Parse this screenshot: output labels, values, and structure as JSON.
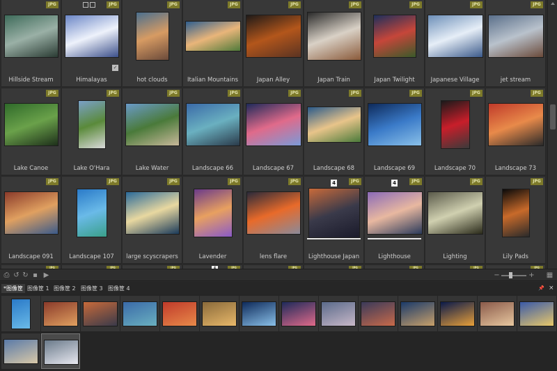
{
  "grid": {
    "badge": "JPG",
    "rows": [
      [
        {
          "caption": "Hillside Stream",
          "colors": [
            "#3e6b5a",
            "#9ab0a6",
            "#2a3b33"
          ]
        },
        {
          "caption": "Himalayas",
          "colors": [
            "#6b86c6",
            "#eef2fb",
            "#3b4f8a"
          ],
          "tr_icons": true,
          "checked": true,
          "check_glyph": "✓"
        },
        {
          "caption": "hot clouds",
          "colors": [
            "#4b6f8e",
            "#d79b63",
            "#6b4a3a"
          ]
        },
        {
          "caption": "Italian Mountains",
          "colors": [
            "#2f5e8e",
            "#e9b57a",
            "#4f7a3a"
          ]
        },
        {
          "caption": "Japan Alley",
          "colors": [
            "#1f1a18",
            "#b3561b",
            "#5a3322"
          ]
        },
        {
          "caption": "Japan Train",
          "colors": [
            "#2b2b2b",
            "#d9d1c6",
            "#8a5a3a"
          ]
        },
        {
          "caption": "Japan Twilight",
          "colors": [
            "#1d2f5c",
            "#c6463a",
            "#3a5a2a"
          ]
        },
        {
          "caption": "Japanese Village",
          "colors": [
            "#6d8fb8",
            "#e6eef7",
            "#3b5a8a"
          ]
        },
        {
          "caption": "jet stream",
          "colors": [
            "#5a6f8a",
            "#b9c2cc",
            "#6a4a3a"
          ]
        }
      ],
      [
        {
          "caption": "Lake Canoe",
          "colors": [
            "#2f6a2a",
            "#6aa14a",
            "#1d2f1a"
          ]
        },
        {
          "caption": "Lake O'Hara",
          "colors": [
            "#7aa0c8",
            "#5a8a3a",
            "#d9d9d9"
          ]
        },
        {
          "caption": "Lake Water",
          "colors": [
            "#6a9ac8",
            "#4a7a3a",
            "#c8b89a"
          ]
        },
        {
          "caption": "Landscape 66",
          "colors": [
            "#3a6aa8",
            "#6ab0c0",
            "#2a3a4a"
          ]
        },
        {
          "caption": "Landscape 67",
          "colors": [
            "#1e2a5a",
            "#e06a8a",
            "#7a9ad8"
          ]
        },
        {
          "caption": "Landscape 68",
          "colors": [
            "#2a5a8a",
            "#e8c48a",
            "#4a7a3a"
          ]
        },
        {
          "caption": "Landscape 69",
          "colors": [
            "#0e2a5a",
            "#3a7ac8",
            "#8ac0e8"
          ]
        },
        {
          "caption": "Landscape 70",
          "colors": [
            "#1a1a1a",
            "#c81e2a",
            "#3a3a3a"
          ]
        },
        {
          "caption": "Landscape 73",
          "colors": [
            "#c03a2a",
            "#e88a4a",
            "#2a2a2a"
          ]
        }
      ],
      [
        {
          "caption": "Landscape 091",
          "colors": [
            "#8a3a2a",
            "#e0a060",
            "#3a5a8a"
          ]
        },
        {
          "caption": "Landscape 107",
          "colors": [
            "#2a7ac8",
            "#6abae8",
            "#3aa08a"
          ]
        },
        {
          "caption": "large scyscrapers",
          "colors": [
            "#2a6a9a",
            "#e8d8a0",
            "#1a3a5a"
          ]
        },
        {
          "caption": "Lavender",
          "colors": [
            "#6a3a8a",
            "#e8a060",
            "#8a5ac8"
          ]
        },
        {
          "caption": "lens flare",
          "colors": [
            "#2a2a3a",
            "#e86a2a",
            "#8a8a9a"
          ]
        },
        {
          "caption": "Lighthouse Japan",
          "colors": [
            "#c86a3a",
            "#3a3a4a",
            "#1a1a2a"
          ],
          "number": "4",
          "selected": true
        },
        {
          "caption": "Lighthouse",
          "colors": [
            "#8a6ab8",
            "#e8b8a0",
            "#2a3a5a"
          ],
          "number": "4",
          "selected": true
        },
        {
          "caption": "Lighting",
          "colors": [
            "#5a5a4a",
            "#d0d0b0",
            "#2a2a1a"
          ]
        },
        {
          "caption": "Lily Pads",
          "colors": [
            "#0a0a0a",
            "#c86a2a",
            "#2a2a2a"
          ]
        }
      ]
    ],
    "partial_row_number": "4"
  },
  "toolbar": {
    "left_icons": [
      "export-icon",
      "rotate-left-icon",
      "rotate-right-icon",
      "delete-icon",
      "slideshow-icon"
    ],
    "left_glyphs": [
      "⎙",
      "↺",
      "↻",
      "▪",
      "▶"
    ],
    "zoom_out_glyph": "−",
    "zoom_in_glyph": "+",
    "zoom_level": 0.35,
    "grid_view_glyph": "▦"
  },
  "tabs": {
    "items": [
      "*图像筐",
      "图像筐 1",
      "图像筐 2",
      "图像筐 3",
      "图像筐 4"
    ],
    "active_index": 0,
    "pin_glyph": "📌",
    "close_glyph": "×"
  },
  "strip": {
    "items": [
      {
        "colors": [
          "#2a7ac8",
          "#6abae8"
        ]
      },
      {
        "colors": [
          "#8a3a2a",
          "#e0a060"
        ]
      },
      {
        "colors": [
          "#c86a3a",
          "#3a3a4a"
        ]
      },
      {
        "colors": [
          "#3a6aa8",
          "#6ab0c0"
        ]
      },
      {
        "colors": [
          "#c03a2a",
          "#e88a4a"
        ]
      },
      {
        "colors": [
          "#8a6a3a",
          "#e8b86a"
        ]
      },
      {
        "colors": [
          "#0e2a5a",
          "#8ac0e8"
        ]
      },
      {
        "colors": [
          "#1e2a5a",
          "#e06a8a"
        ]
      },
      {
        "colors": [
          "#5a6a8a",
          "#c8b8c8"
        ]
      },
      {
        "colors": [
          "#3a3a5a",
          "#c86a4a"
        ]
      },
      {
        "colors": [
          "#1a3a6a",
          "#c8a06a"
        ]
      },
      {
        "colors": [
          "#0a1a4a",
          "#e8a03a"
        ]
      },
      {
        "colors": [
          "#8a5a4a",
          "#e8c8a0"
        ]
      },
      {
        "colors": [
          "#3a5aa8",
          "#e8c86a"
        ]
      },
      {
        "colors": [
          "#5a7aa8",
          "#d8c8a8"
        ]
      },
      {
        "colors": [
          "#6a7a8a",
          "#e8e8f0"
        ],
        "active": true
      }
    ]
  }
}
